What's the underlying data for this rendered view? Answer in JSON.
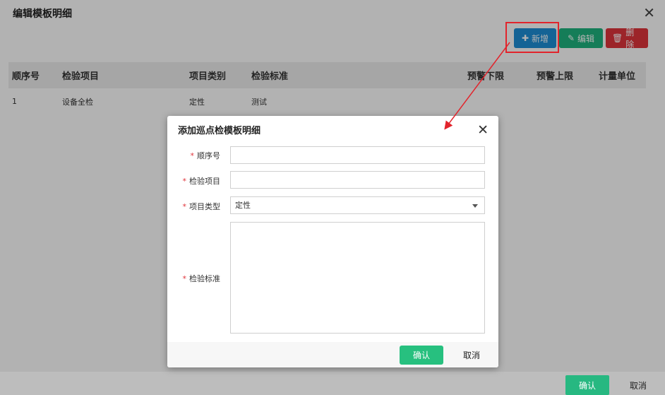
{
  "outer_dialog": {
    "title": "编辑模板明细",
    "toolbar": {
      "add_label": "新增",
      "edit_label": "编辑",
      "delete_label": "删除"
    },
    "table": {
      "columns": [
        "顺序号",
        "检验项目",
        "项目类别",
        "检验标准",
        "预警下限",
        "预警上限",
        "计量单位"
      ],
      "rows": [
        {
          "seq": "1",
          "item": "设备全检",
          "category": "定性",
          "standard": "测试"
        }
      ]
    },
    "ok_label": "确认",
    "cancel_label": "取消"
  },
  "modal": {
    "title": "添加巡点检模板明细",
    "fields": {
      "seq_label": "顺序号",
      "item_label": "检验项目",
      "type_label": "项目类型",
      "type_value": "定性",
      "standard_label": "检验标准",
      "required_mark": "*"
    },
    "ok_label": "确认",
    "cancel_label": "取消"
  },
  "colors": {
    "primary_blue": "#1e8fd6",
    "green": "#1fb47e",
    "red": "#e0343b",
    "highlight": "#e2242c"
  },
  "icons": {
    "add": "plus-icon",
    "edit": "edit-icon",
    "delete": "trash-icon",
    "close": "close-icon"
  }
}
